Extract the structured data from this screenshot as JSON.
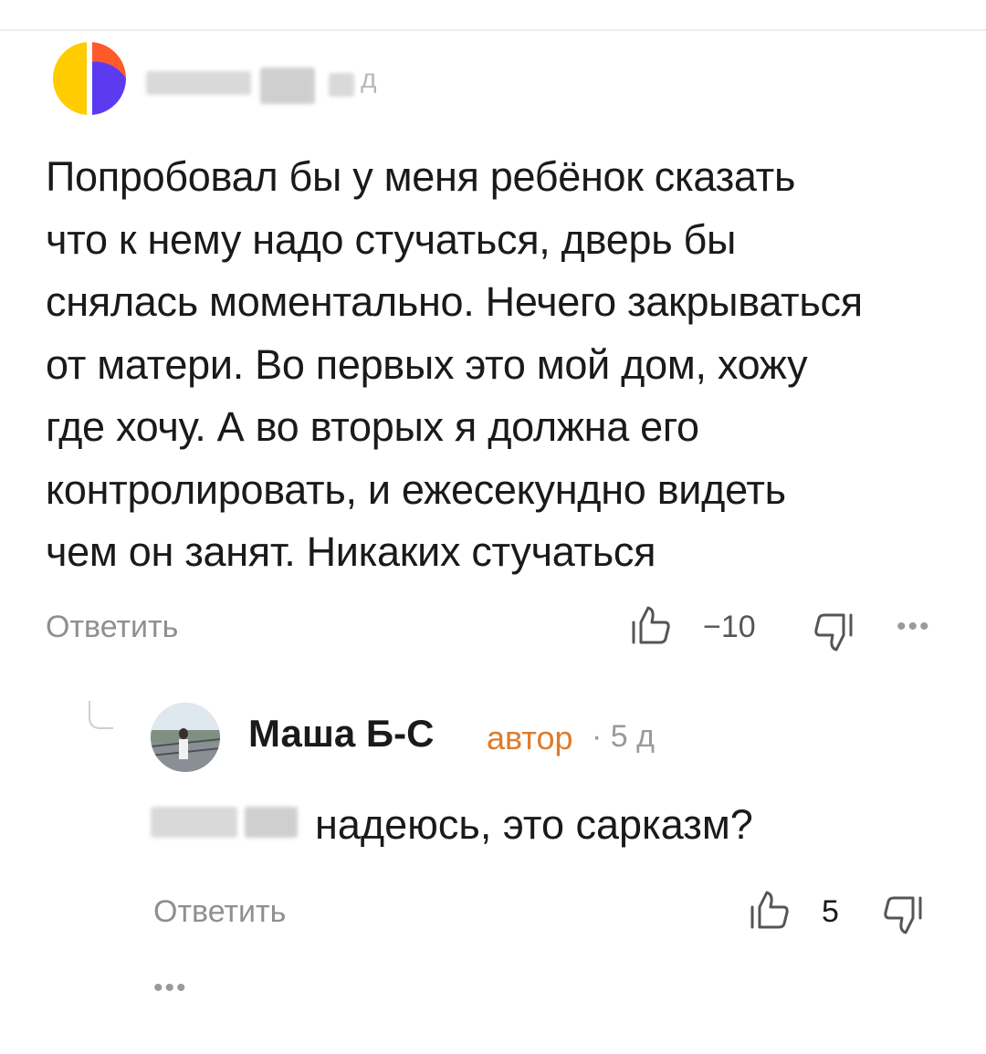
{
  "main_comment": {
    "author_time_fragment": "д",
    "lines": [
      "Попробовал бы у меня ребёнок сказать",
      "что к нему надо стучаться, дверь бы",
      "снялась моментально. Нечего закрываться",
      "от матери. Во первых это мой дом, хожу",
      "где хочу. А во вторых я должна его",
      "контролировать, и ежесекундно видеть",
      "чем он занят. Никаких стучаться"
    ],
    "reply_label": "Ответить",
    "likes": "−10",
    "more": "•••"
  },
  "reply_comment": {
    "author": "Маша Б-С",
    "badge": "автор",
    "time": "· 5 д",
    "text": "надеюсь, это сарказм?",
    "reply_label": "Ответить",
    "likes": "5",
    "more": "•••"
  },
  "colors": {
    "author_badge": "#e07b2a",
    "muted": "#8f8f8f"
  }
}
